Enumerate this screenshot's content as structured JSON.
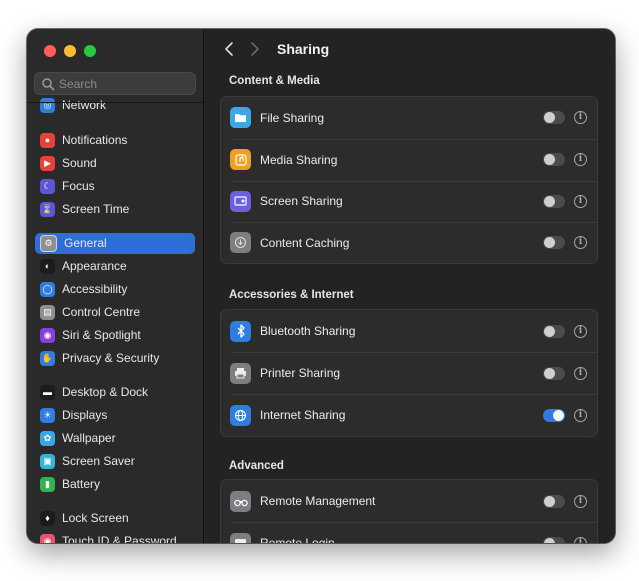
{
  "window": {
    "title": "Sharing"
  },
  "search": {
    "placeholder": "Search"
  },
  "sidebar": {
    "items": [
      {
        "label": "Network",
        "icon": "globe-icon",
        "color": "#2f7de1"
      },
      {
        "label": "Notifications",
        "icon": "bell-icon",
        "color": "#e8413a"
      },
      {
        "label": "Sound",
        "icon": "speaker-icon",
        "color": "#e8413a"
      },
      {
        "label": "Focus",
        "icon": "moon-icon",
        "color": "#5b57d8"
      },
      {
        "label": "Screen Time",
        "icon": "hourglass-icon",
        "color": "#5b57d8"
      },
      {
        "label": "General",
        "icon": "gear-icon",
        "color": "#8e8e93",
        "selected": true
      },
      {
        "label": "Appearance",
        "icon": "appearance-icon",
        "color": "#1c1c1e"
      },
      {
        "label": "Accessibility",
        "icon": "accessibility-icon",
        "color": "#2f7de1"
      },
      {
        "label": "Control Centre",
        "icon": "control-centre-icon",
        "color": "#8e8e93"
      },
      {
        "label": "Siri & Spotlight",
        "icon": "siri-icon",
        "color": "#8a3ed8"
      },
      {
        "label": "Privacy & Security",
        "icon": "hand-icon",
        "color": "#2f7de1"
      },
      {
        "label": "Desktop & Dock",
        "icon": "dock-icon",
        "color": "#1c1c1e"
      },
      {
        "label": "Displays",
        "icon": "sun-icon",
        "color": "#2f7de1"
      },
      {
        "label": "Wallpaper",
        "icon": "flower-icon",
        "color": "#35a9e8"
      },
      {
        "label": "Screen Saver",
        "icon": "screensaver-icon",
        "color": "#35b5d6"
      },
      {
        "label": "Battery",
        "icon": "battery-icon",
        "color": "#32b350"
      },
      {
        "label": "Lock Screen",
        "icon": "lock-icon",
        "color": "#1c1c1e"
      },
      {
        "label": "Touch ID & Password",
        "icon": "fingerprint-icon",
        "color": "#e8546a"
      }
    ]
  },
  "sections": [
    {
      "title": "Content & Media",
      "rows": [
        {
          "label": "File Sharing",
          "icon": "folder-icon",
          "color": "#3aa8e6",
          "on": false
        },
        {
          "label": "Media Sharing",
          "icon": "music-icon",
          "color": "#f0a020",
          "on": false
        },
        {
          "label": "Screen Sharing",
          "icon": "screen-sharing-icon",
          "color": "#6a5fdd",
          "on": false
        },
        {
          "label": "Content Caching",
          "icon": "download-icon",
          "color": "#7d7d82",
          "on": false
        }
      ]
    },
    {
      "title": "Accessories & Internet",
      "rows": [
        {
          "label": "Bluetooth Sharing",
          "icon": "bluetooth-icon",
          "color": "#2f7de1",
          "on": false
        },
        {
          "label": "Printer Sharing",
          "icon": "printer-icon",
          "color": "#7d7d82",
          "on": false
        },
        {
          "label": "Internet Sharing",
          "icon": "globe-icon",
          "color": "#2f7de1",
          "on": true
        }
      ]
    },
    {
      "title": "Advanced",
      "rows": [
        {
          "label": "Remote Management",
          "icon": "binoculars-icon",
          "color": "#7d7d82",
          "on": false
        },
        {
          "label": "Remote Login",
          "icon": "terminal-icon",
          "color": "#7d7d82",
          "on": false
        }
      ]
    }
  ]
}
